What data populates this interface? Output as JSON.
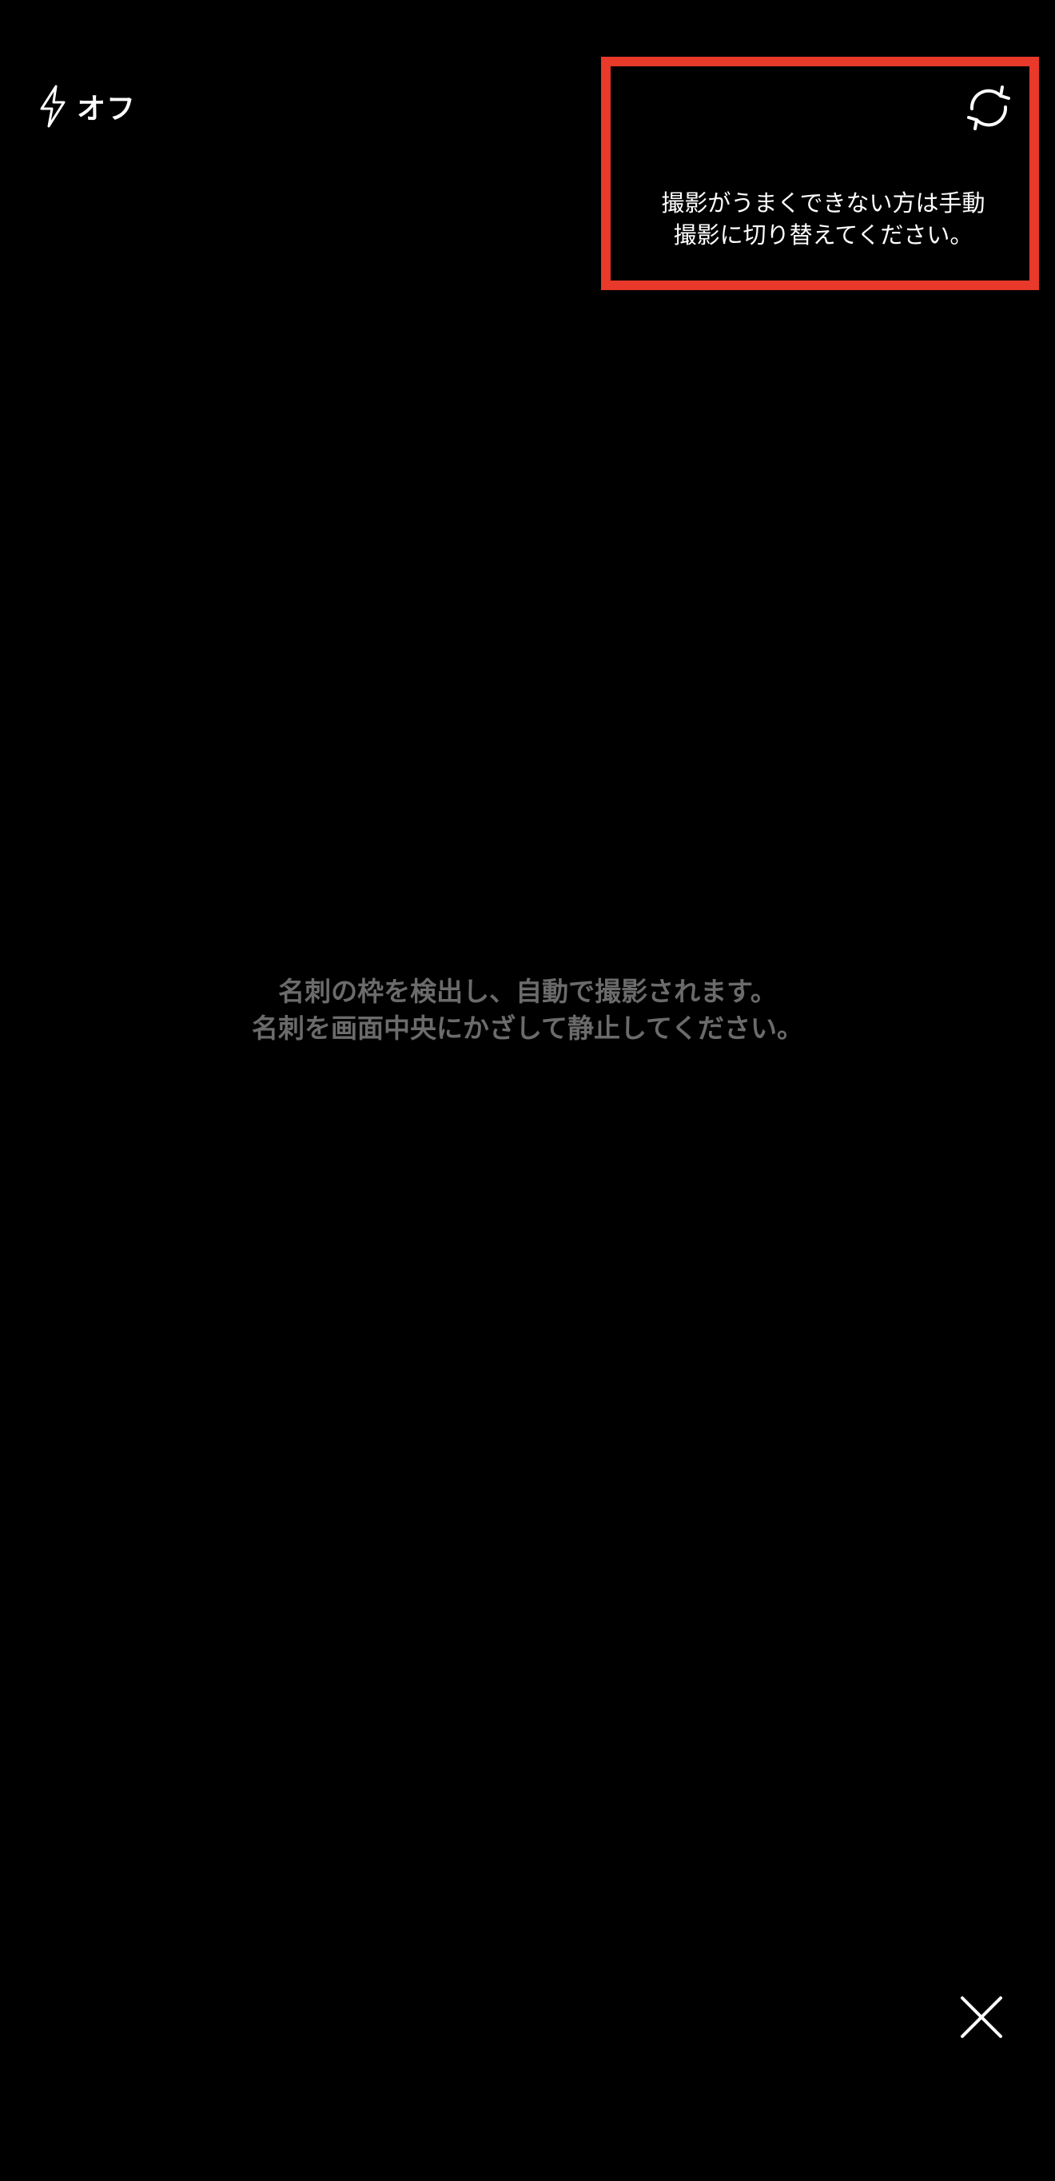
{
  "flash": {
    "icon": "lightning-icon",
    "label": "オフ"
  },
  "mode_switch": {
    "icon": "refresh-icon",
    "hint_line1": "撮影がうまくできない方は手動",
    "hint_line2": "撮影に切り替えてください。"
  },
  "guide": {
    "line1": "名刺の枠を検出し、自動で撮影されます。",
    "line2": "名刺を画面中央にかざして静止してください。"
  },
  "close": {
    "icon": "close-icon"
  },
  "colors": {
    "background": "#000000",
    "highlight": "#e8392a",
    "guide_text": "#6b6b6b",
    "primary_text": "#ffffff"
  }
}
